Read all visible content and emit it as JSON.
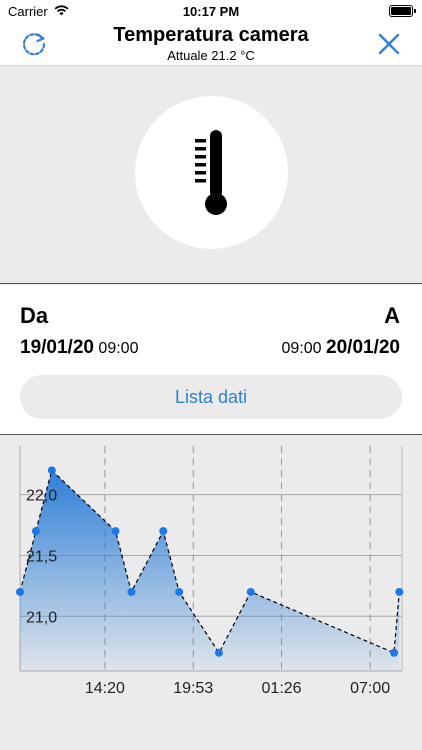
{
  "status_bar": {
    "carrier": "Carrier",
    "time": "10:17 PM"
  },
  "nav": {
    "title": "Temperatura camera",
    "subtitle": "Attuale 21.2 °C",
    "accent_color": "#2f7fd8"
  },
  "sensor_icon": "thermometer-icon",
  "range": {
    "from_label": "Da",
    "to_label": "A",
    "from_date": "19/01/20",
    "from_time": "09:00",
    "to_time": "09:00",
    "to_date": "20/01/20"
  },
  "list_button_label": "Lista dati",
  "chart_data": {
    "type": "area",
    "x_ticks": [
      "14:20",
      "19:53",
      "01:26",
      "07:00"
    ],
    "y_ticks": [
      "22,0",
      "21,5",
      "21,0"
    ],
    "ylim": [
      20.55,
      22.4
    ],
    "xlim": [
      "19/01/20 09:00",
      "20/01/20 09:00"
    ],
    "x": [
      "09:00",
      "10:00",
      "11:00",
      "15:00",
      "16:00",
      "18:00",
      "19:00",
      "21:30",
      "23:30",
      "08:30",
      "08:50"
    ],
    "values": [
      21.2,
      21.7,
      22.2,
      21.7,
      21.2,
      21.7,
      21.2,
      20.7,
      21.2,
      20.7,
      21.2
    ],
    "grid": true,
    "fill_color": "#2f7fd8",
    "point_color": "#1e78e6"
  }
}
